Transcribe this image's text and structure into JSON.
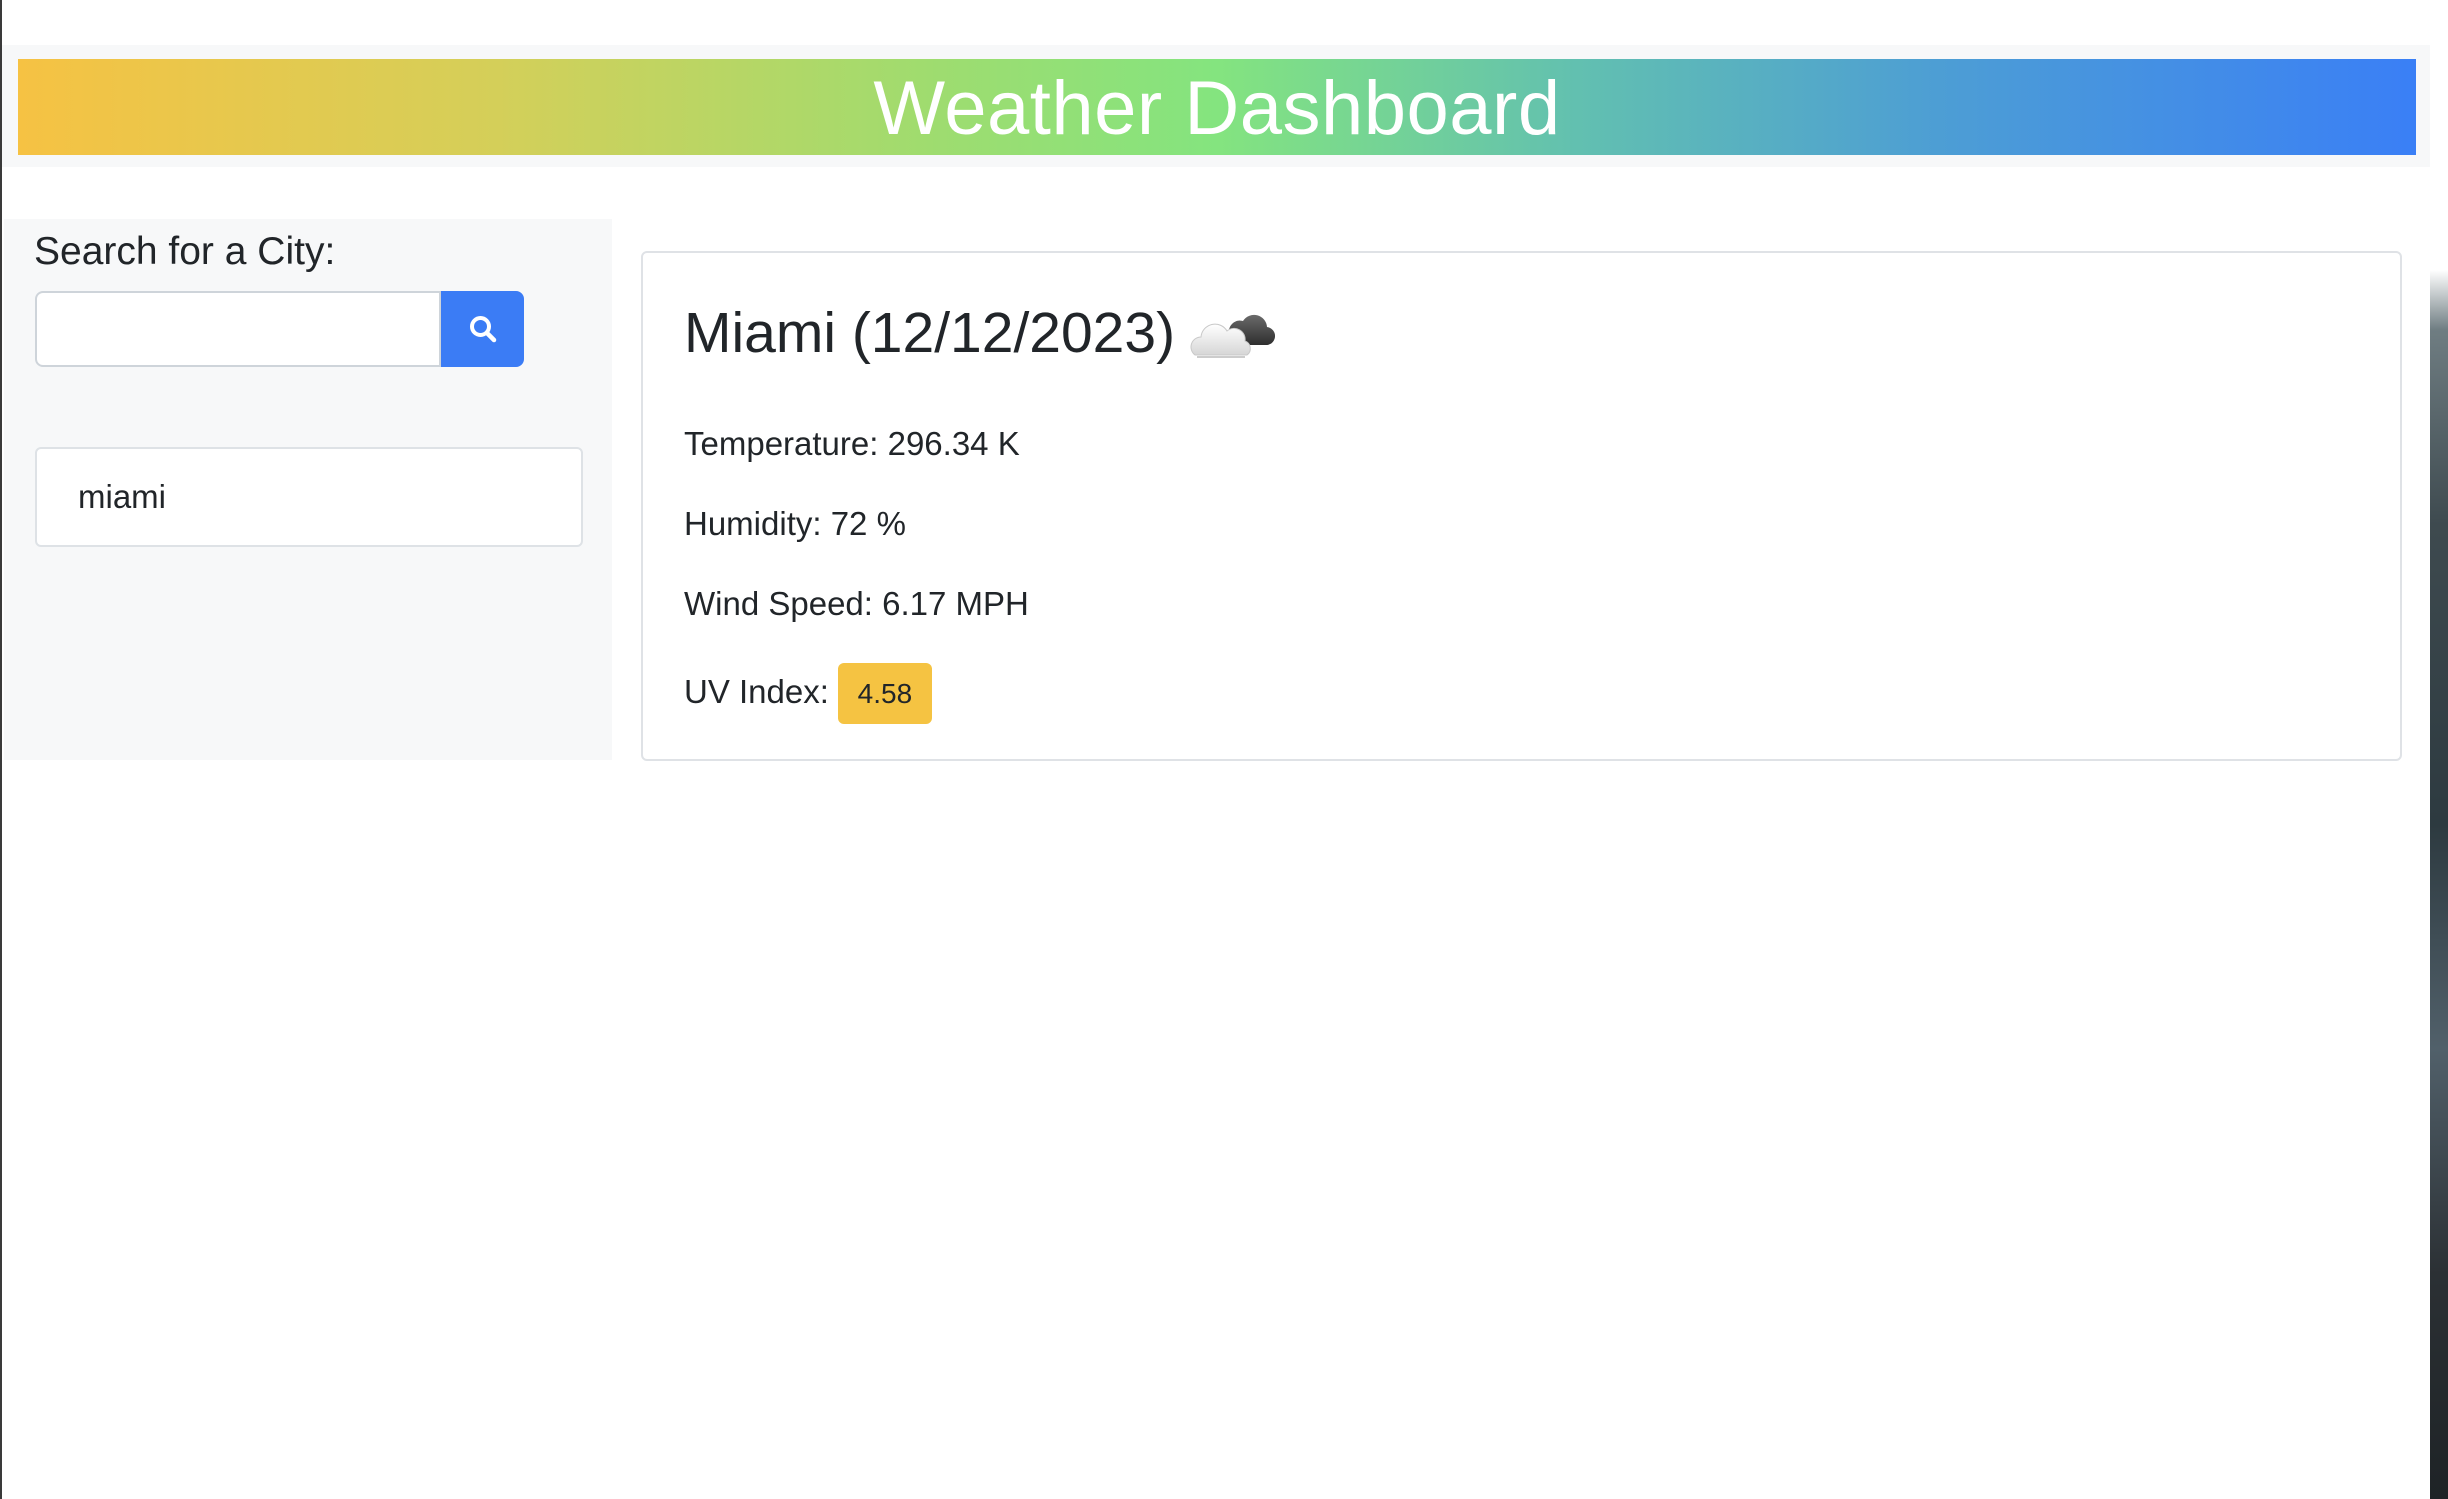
{
  "header": {
    "title": "Weather Dashboard"
  },
  "sidebar": {
    "search_label": "Search for a City:",
    "search_input_value": "",
    "search_button_icon": "search-icon",
    "history": [
      "miami"
    ]
  },
  "current": {
    "heading": "Miami (12/12/2023)",
    "icon": "cloud-icon",
    "temperature": "Temperature: 296.34 K",
    "humidity": "Humidity: 72 %",
    "wind": "Wind Speed: 6.17 MPH",
    "uv_label": "UV Index:",
    "uv_value": "4.58"
  },
  "colors": {
    "header_gradient_start": "#f6c243",
    "header_gradient_mid": "#84e47f",
    "header_gradient_end": "#3a7ff6",
    "search_button": "#3b7cf5",
    "uv_badge": "#f5c342"
  }
}
